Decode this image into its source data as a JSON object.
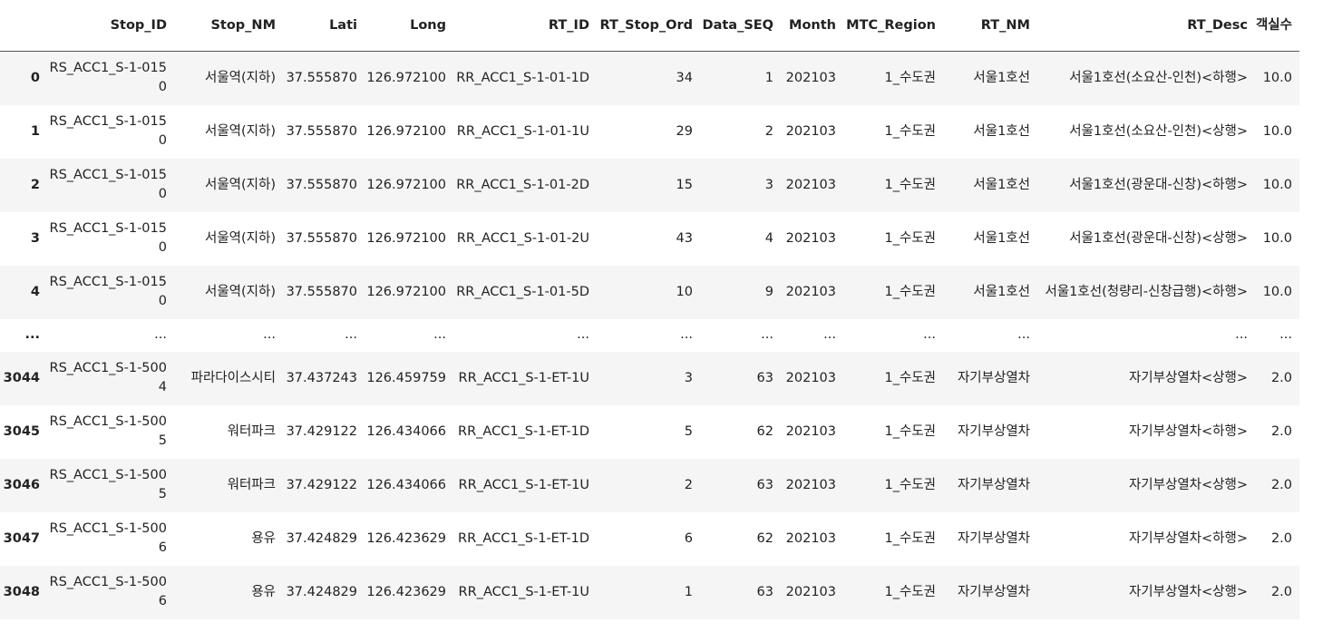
{
  "columns": [
    "",
    "Stop_ID",
    "Stop_NM",
    "Lati",
    "Long",
    "RT_ID",
    "RT_Stop_Ord",
    "Data_SEQ",
    "Month",
    "MTC_Region",
    "RT_NM",
    "RT_Desc",
    "객실수"
  ],
  "rows": [
    {
      "index": "0",
      "cells": [
        "RS_ACC1_S-1-0150",
        "서울역(지하)",
        "37.555870",
        "126.972100",
        "RR_ACC1_S-1-01-1D",
        "34",
        "1",
        "202103",
        "1_수도권",
        "서울1호선",
        "서울1호선(소요산-인천)<하행>",
        "10.0"
      ]
    },
    {
      "index": "1",
      "cells": [
        "RS_ACC1_S-1-0150",
        "서울역(지하)",
        "37.555870",
        "126.972100",
        "RR_ACC1_S-1-01-1U",
        "29",
        "2",
        "202103",
        "1_수도권",
        "서울1호선",
        "서울1호선(소요산-인천)<상행>",
        "10.0"
      ]
    },
    {
      "index": "2",
      "cells": [
        "RS_ACC1_S-1-0150",
        "서울역(지하)",
        "37.555870",
        "126.972100",
        "RR_ACC1_S-1-01-2D",
        "15",
        "3",
        "202103",
        "1_수도권",
        "서울1호선",
        "서울1호선(광운대-신창)<하행>",
        "10.0"
      ]
    },
    {
      "index": "3",
      "cells": [
        "RS_ACC1_S-1-0150",
        "서울역(지하)",
        "37.555870",
        "126.972100",
        "RR_ACC1_S-1-01-2U",
        "43",
        "4",
        "202103",
        "1_수도권",
        "서울1호선",
        "서울1호선(광운대-신창)<상행>",
        "10.0"
      ]
    },
    {
      "index": "4",
      "cells": [
        "RS_ACC1_S-1-0150",
        "서울역(지하)",
        "37.555870",
        "126.972100",
        "RR_ACC1_S-1-01-5D",
        "10",
        "9",
        "202103",
        "1_수도권",
        "서울1호선",
        "서울1호선(청량리-신창급행)<하행>",
        "10.0"
      ]
    },
    {
      "index": "...",
      "cells": [
        "...",
        "...",
        "...",
        "...",
        "...",
        "...",
        "...",
        "...",
        "...",
        "...",
        "...",
        "..."
      ]
    },
    {
      "index": "3044",
      "cells": [
        "RS_ACC1_S-1-5004",
        "파라다이스시티",
        "37.437243",
        "126.459759",
        "RR_ACC1_S-1-ET-1U",
        "3",
        "63",
        "202103",
        "1_수도권",
        "자기부상열차",
        "자기부상열차<상행>",
        "2.0"
      ]
    },
    {
      "index": "3045",
      "cells": [
        "RS_ACC1_S-1-5005",
        "워터파크",
        "37.429122",
        "126.434066",
        "RR_ACC1_S-1-ET-1D",
        "5",
        "62",
        "202103",
        "1_수도권",
        "자기부상열차",
        "자기부상열차<하행>",
        "2.0"
      ]
    },
    {
      "index": "3046",
      "cells": [
        "RS_ACC1_S-1-5005",
        "워터파크",
        "37.429122",
        "126.434066",
        "RR_ACC1_S-1-ET-1U",
        "2",
        "63",
        "202103",
        "1_수도권",
        "자기부상열차",
        "자기부상열차<상행>",
        "2.0"
      ]
    },
    {
      "index": "3047",
      "cells": [
        "RS_ACC1_S-1-5006",
        "용유",
        "37.424829",
        "126.423629",
        "RR_ACC1_S-1-ET-1D",
        "6",
        "62",
        "202103",
        "1_수도권",
        "자기부상열차",
        "자기부상열차<하행>",
        "2.0"
      ]
    },
    {
      "index": "3048",
      "cells": [
        "RS_ACC1_S-1-5006",
        "용유",
        "37.424829",
        "126.423629",
        "RR_ACC1_S-1-ET-1U",
        "1",
        "63",
        "202103",
        "1_수도권",
        "자기부상열차",
        "자기부상열차<상행>",
        "2.0"
      ]
    }
  ]
}
